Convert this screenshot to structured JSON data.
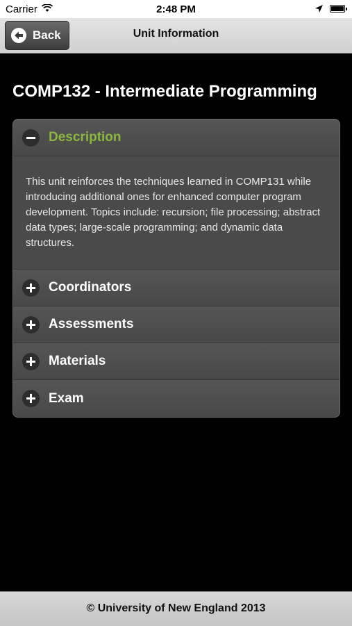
{
  "status_bar": {
    "carrier": "Carrier",
    "time": "2:48 PM"
  },
  "nav": {
    "back_label": "Back",
    "title": "Unit Information"
  },
  "unit": {
    "title": "COMP132 - Intermediate Programming"
  },
  "sections": [
    {
      "label": "Description",
      "expanded": true,
      "icon": "minus-icon",
      "body": "This unit reinforces the techniques learned in COMP131 while introducing additional ones for enhanced computer program development. Topics include: recursion; file processing; abstract data types; large-scale programming; and dynamic data structures."
    },
    {
      "label": "Coordinators",
      "expanded": false,
      "icon": "plus-icon"
    },
    {
      "label": "Assessments",
      "expanded": false,
      "icon": "plus-icon"
    },
    {
      "label": "Materials",
      "expanded": false,
      "icon": "plus-icon"
    },
    {
      "label": "Exam",
      "expanded": false,
      "icon": "plus-icon"
    }
  ],
  "footer": {
    "text": "© University of New England 2013"
  },
  "colors": {
    "active_section": "#8ab83d",
    "background": "#000000",
    "panel": "#4d4d4d"
  }
}
